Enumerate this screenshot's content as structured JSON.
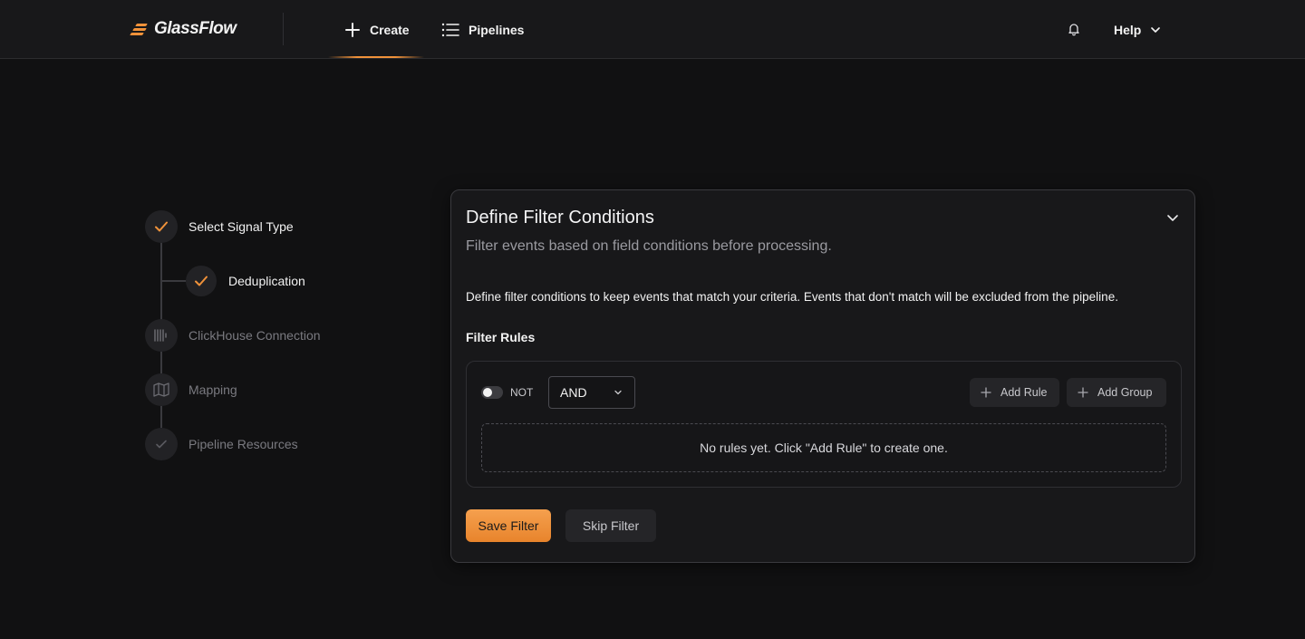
{
  "header": {
    "logo_text": "GlassFlow",
    "nav": {
      "create_label": "Create",
      "pipelines_label": "Pipelines"
    },
    "help_label": "Help",
    "accent_color": "#f0923a"
  },
  "stepper": {
    "steps": [
      {
        "label": "Select Signal Type",
        "status": "done",
        "icon": "check-icon"
      },
      {
        "label": "Deduplication",
        "status": "done",
        "icon": "check-icon"
      },
      {
        "label": "ClickHouse Connection",
        "status": "pending",
        "icon": "database-bars-icon"
      },
      {
        "label": "Mapping",
        "status": "pending",
        "icon": "map-icon"
      },
      {
        "label": "Pipeline Resources",
        "status": "pending",
        "icon": "check-icon"
      }
    ]
  },
  "card": {
    "title": "Define Filter Conditions",
    "subtitle": "Filter events based on field conditions before processing.",
    "description": "Define filter conditions to keep events that match your criteria. Events that don't match will be excluded from the pipeline.",
    "rules_label": "Filter Rules",
    "not_label": "NOT",
    "combinator_value": "AND",
    "add_rule_label": "Add Rule",
    "add_group_label": "Add Group",
    "empty_message": "No rules yet. Click \"Add Rule\" to create one.",
    "save_label": "Save Filter",
    "skip_label": "Skip Filter"
  }
}
